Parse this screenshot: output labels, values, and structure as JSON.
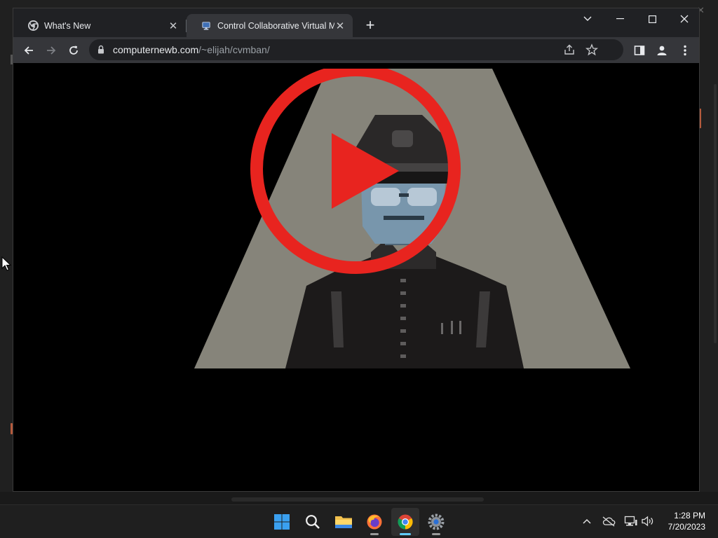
{
  "browser": {
    "tabs": [
      {
        "title": "What's New",
        "favicon": "chrome-icon",
        "active": false
      },
      {
        "title": "Control Collaborative Virtual Machines",
        "favicon": "cvm-icon",
        "active": true
      }
    ],
    "new_tab_label": "+",
    "address": {
      "domain": "computernewb.com",
      "path": "/~elijah/cvmban/"
    }
  },
  "page": {
    "content": "pixel-art figure in officer cap and sunglasses under a spotlight, with a red play-button overlay",
    "colors": {
      "background": "#000000",
      "spotlight": "#86847a",
      "play_overlay": "#e8241f"
    }
  },
  "taskbar": {
    "apps": [
      "start-icon",
      "search-icon",
      "file-explorer-icon",
      "firefox-icon",
      "chrome-icon",
      "settings-icon"
    ],
    "active_app": "chrome-icon",
    "clock": {
      "time": "1:28 PM",
      "date": "7/20/2023"
    }
  }
}
